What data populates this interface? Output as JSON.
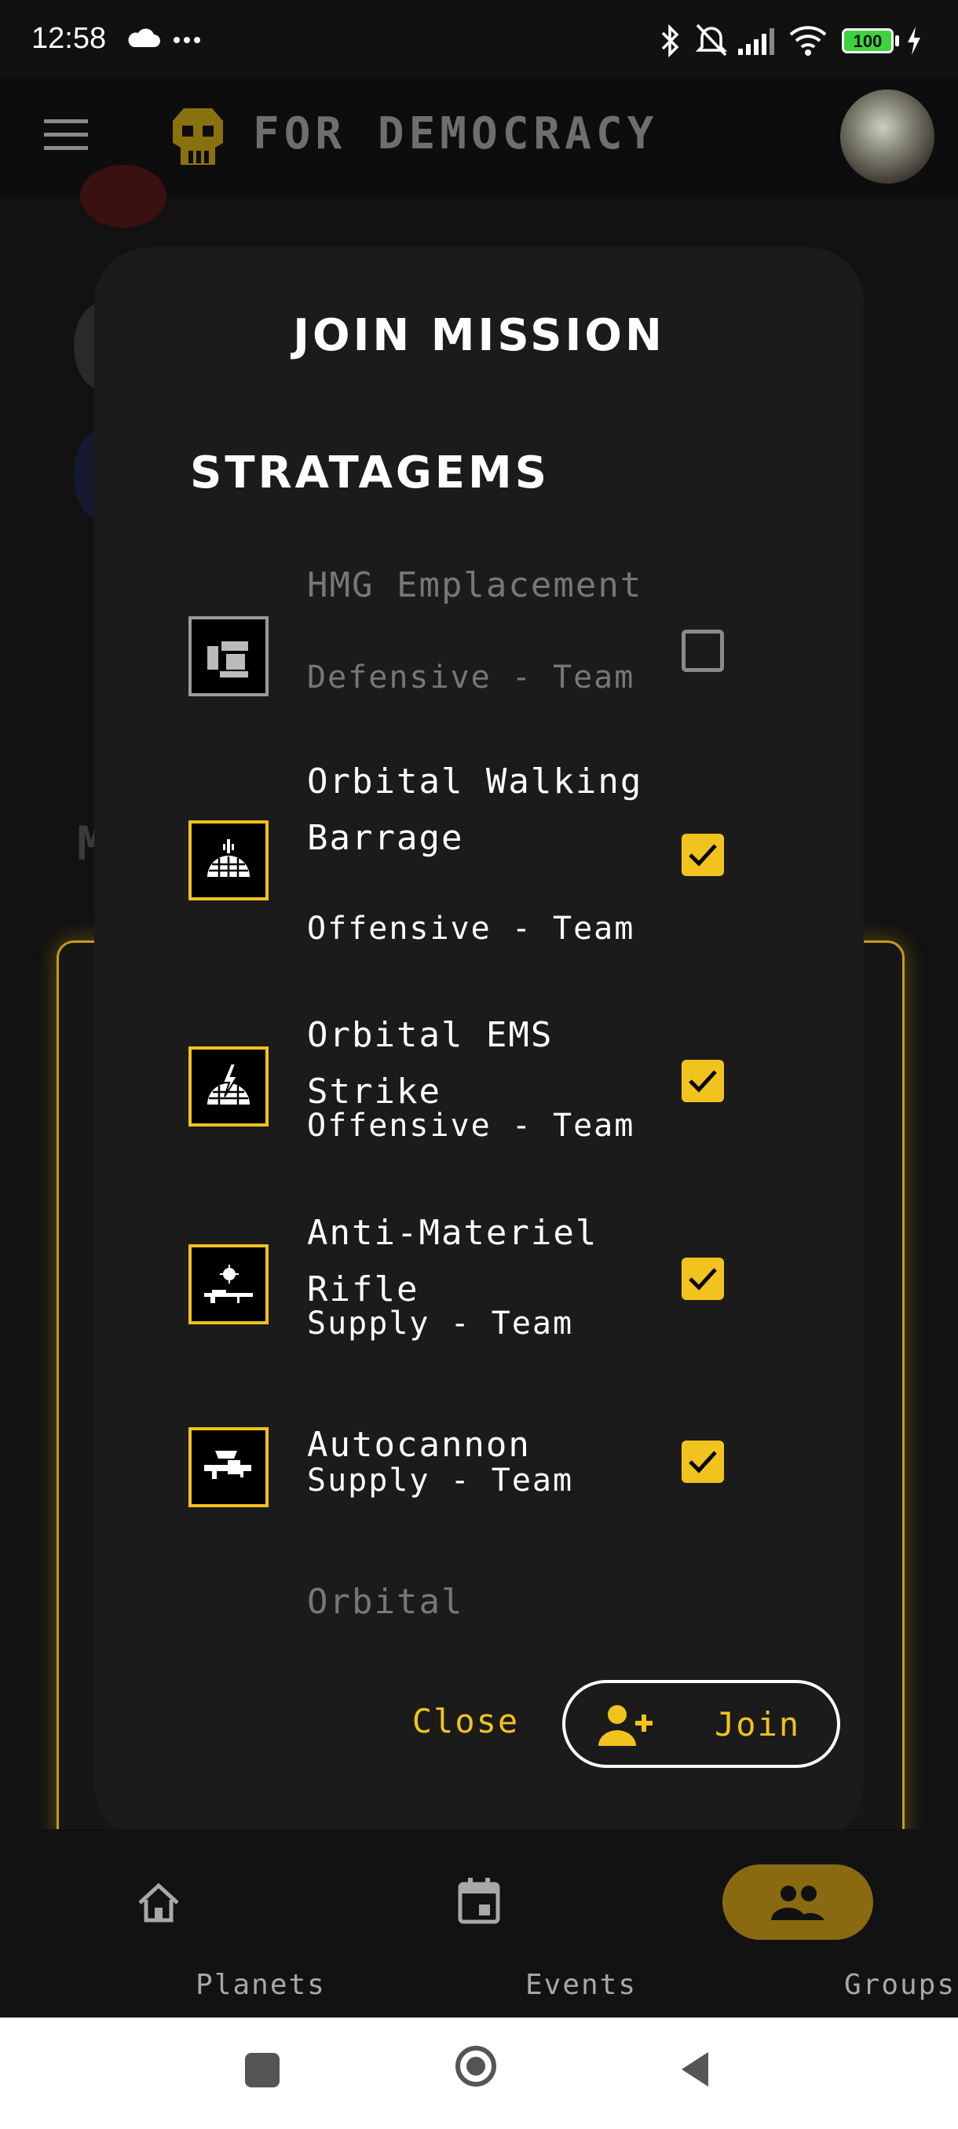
{
  "status_bar": {
    "time": "12:58",
    "battery": "100"
  },
  "app_bar": {
    "title": "FOR DEMOCRACY"
  },
  "dialog": {
    "title": "JOIN MISSION",
    "section": "STRATAGEMS",
    "items": [
      {
        "name": "HMG Emplacement",
        "category": "Defensive - Team",
        "checked": false,
        "enabled": false,
        "icon": "hmg-emplacement-icon"
      },
      {
        "name": "Orbital Walking Barrage",
        "category": "Offensive - Team",
        "checked": true,
        "enabled": true,
        "icon": "orbital-walking-barrage-icon"
      },
      {
        "name": "Orbital EMS Strike",
        "category": "Offensive - Team",
        "checked": true,
        "enabled": true,
        "icon": "orbital-ems-strike-icon"
      },
      {
        "name": "Anti-Materiel Rifle",
        "category": "Supply - Team",
        "checked": true,
        "enabled": true,
        "icon": "anti-materiel-rifle-icon"
      },
      {
        "name": "Autocannon",
        "category": "Supply - Team",
        "checked": true,
        "enabled": true,
        "icon": "autocannon-icon"
      },
      {
        "name": "Orbital",
        "category": "",
        "checked": false,
        "enabled": false,
        "icon": ""
      }
    ],
    "close_label": "Close",
    "join_label": "Join"
  },
  "bottom_nav": {
    "items": [
      {
        "label": "Planets",
        "icon": "home-icon",
        "active": false
      },
      {
        "label": "Events",
        "icon": "calendar-icon",
        "active": false
      },
      {
        "label": "Groups",
        "icon": "groups-icon",
        "active": true
      }
    ]
  },
  "colors": {
    "accent": "#f2c21e",
    "surface": "#1b1b1b",
    "background": "#111111"
  }
}
